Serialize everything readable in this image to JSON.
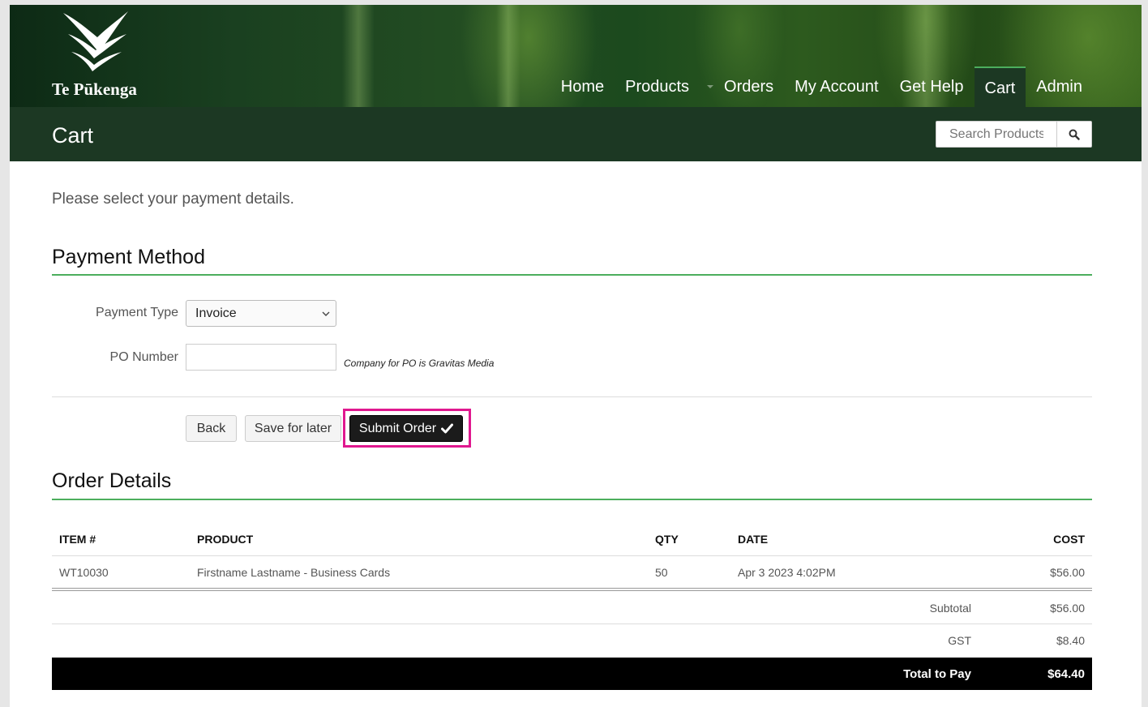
{
  "brand": {
    "name": "Te Pūkenga"
  },
  "nav": {
    "items": [
      {
        "label": "Home"
      },
      {
        "label": "Products"
      },
      {
        "label": "Orders"
      },
      {
        "label": "My Account"
      },
      {
        "label": "Get Help"
      },
      {
        "label": "Cart"
      },
      {
        "label": "Admin"
      }
    ],
    "active": "Cart"
  },
  "page": {
    "title": "Cart"
  },
  "search": {
    "placeholder": "Search Products"
  },
  "intro": "Please select your payment details.",
  "payment": {
    "heading": "Payment Method",
    "type_label": "Payment Type",
    "type_value": "Invoice",
    "po_label": "PO Number",
    "po_value": "",
    "po_hint": "Company for PO is Gravitas Media"
  },
  "actions": {
    "back": "Back",
    "save": "Save for later",
    "submit": "Submit Order"
  },
  "order": {
    "heading": "Order Details",
    "columns": [
      "ITEM #",
      "PRODUCT",
      "QTY",
      "DATE",
      "COST"
    ],
    "rows": [
      {
        "item": "WT10030",
        "product": "Firstname Lastname - Business Cards",
        "qty": "50",
        "date": "Apr 3 2023 4:02PM",
        "cost": "$56.00"
      }
    ],
    "subtotal_label": "Subtotal",
    "subtotal": "$56.00",
    "gst_label": "GST",
    "gst": "$8.40",
    "total_label": "Total to Pay",
    "total": "$64.40"
  },
  "colors": {
    "accent_green": "#4cae5d",
    "header_dark": "#1c3823",
    "highlight": "#e0188f"
  }
}
